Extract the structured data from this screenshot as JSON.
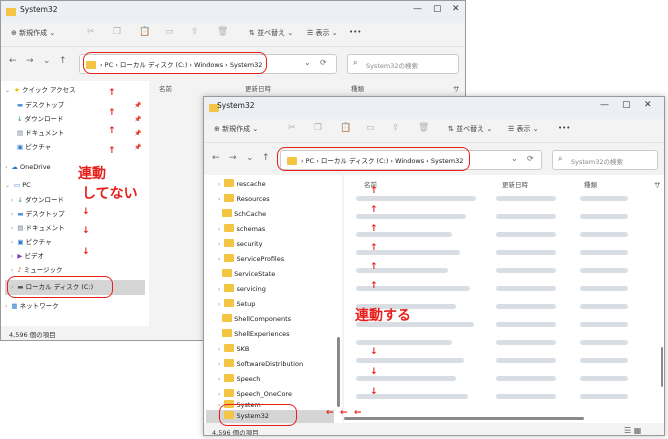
{
  "back_window": {
    "title": "System32",
    "toolbar": {
      "new_label": "新規作成",
      "sort_label": "並べ替え",
      "view_label": "表示",
      "more_label": "•••"
    },
    "address": {
      "pc": "PC",
      "drive": "ローカル ディスク (C:)",
      "windows": "Windows",
      "system32": "System32"
    },
    "search_placeholder": "System32の検索",
    "columns": {
      "name": "名前",
      "date": "更新日時",
      "type": "種類",
      "size": "サ"
    },
    "quick_access": "クイック アクセス",
    "qa_items": [
      "デスクトップ",
      "ダウンロード",
      "ドキュメント",
      "ピクチャ"
    ],
    "onedrive": "OneDrive",
    "pc": "PC",
    "pc_items": [
      "ダウンロード",
      "デスクトップ",
      "ドキュメント",
      "ピクチャ",
      "ビデオ",
      "ミュージック"
    ],
    "local_disk": "ローカル ディスク (C:)",
    "network": "ネットワーク",
    "status": "4,596 個の項目"
  },
  "front_window": {
    "title": "System32",
    "toolbar": {
      "new_label": "新規作成",
      "sort_label": "並べ替え",
      "view_label": "表示",
      "more_label": "•••"
    },
    "address": {
      "pc": "PC",
      "drive": "ローカル ディスク (C:)",
      "windows": "Windows",
      "system32": "System32"
    },
    "search_placeholder": "System32の検索",
    "columns": {
      "name": "名前",
      "date": "更新日時",
      "type": "種類",
      "size": "サ"
    },
    "tree_items": [
      "rescache",
      "Resources",
      "SchCache",
      "schemas",
      "security",
      "ServiceProfiles",
      "ServiceState",
      "servicing",
      "Setup",
      "ShellComponents",
      "ShellExperiences",
      "SKB",
      "SoftwareDistribution",
      "Speech",
      "Speech_OneCore",
      "System",
      "System32"
    ],
    "status": "4,596 個の項目"
  },
  "annotations": {
    "not_linked_line1": "連動",
    "not_linked_line2": "してない",
    "linked": "連動する"
  },
  "colors": {
    "annotation": "#e8201c",
    "folder": "#f4c542",
    "selected": "#d5d5d5"
  }
}
